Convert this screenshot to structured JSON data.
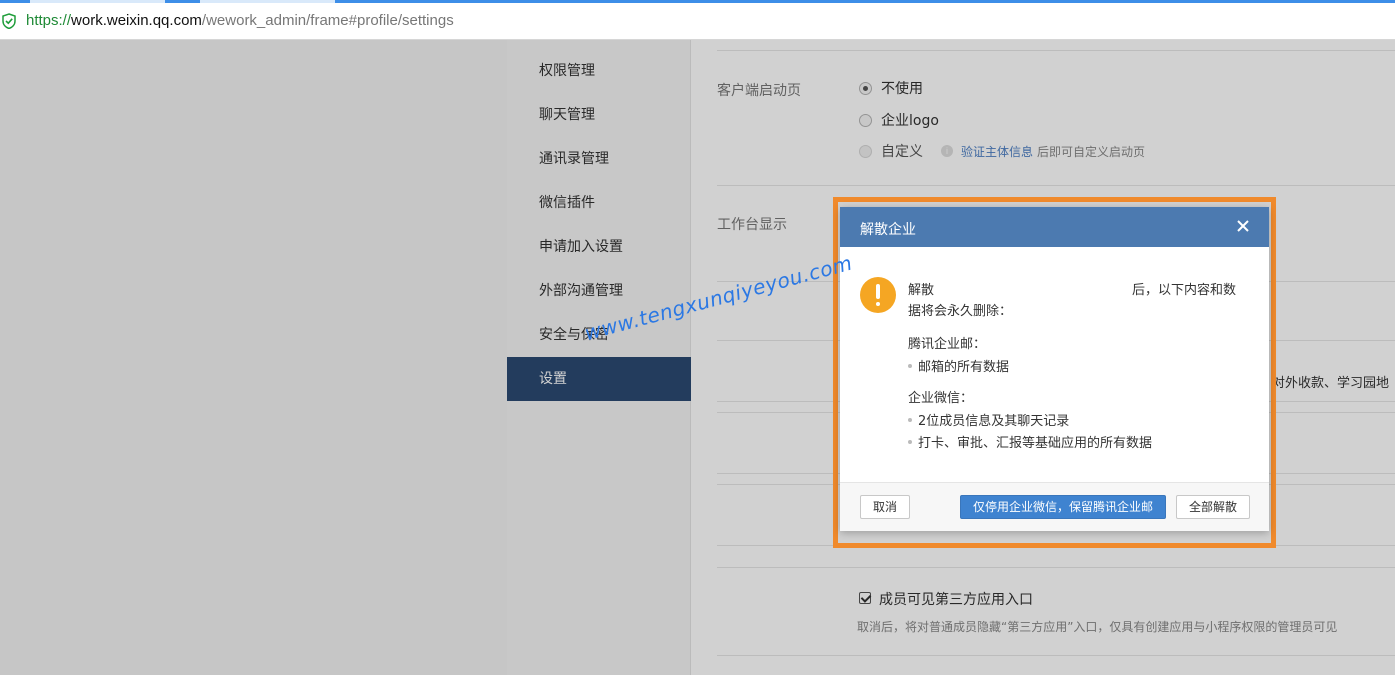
{
  "browser": {
    "url_scheme": "https://",
    "url_host": "work.weixin.qq.com",
    "url_path": "/wework_admin/frame#profile/settings"
  },
  "sidebar": {
    "items": [
      {
        "label": "权限管理"
      },
      {
        "label": "聊天管理"
      },
      {
        "label": "通讯录管理"
      },
      {
        "label": "微信插件"
      },
      {
        "label": "申请加入设置"
      },
      {
        "label": "外部沟通管理"
      },
      {
        "label": "安全与保密"
      },
      {
        "label": "设置",
        "active": true
      }
    ]
  },
  "settings": {
    "launch_page": {
      "label": "客户端启动页",
      "options": [
        {
          "label": "不使用",
          "checked": true
        },
        {
          "label": "企业logo",
          "checked": false
        },
        {
          "label": "自定义",
          "checked": false,
          "disabled": true
        }
      ],
      "verify_link": "验证主体信息",
      "verify_hint": "后即可自定义启动页"
    },
    "workbench": {
      "label": "工作台显示",
      "peek_text": "对外收款、学习园地"
    },
    "third_party": {
      "checkbox_label": "成员可见第三方应用入口",
      "checked": true,
      "description": "取消后，将对普通成员隐藏“第三方应用”入口，仅具有创建应用与小程序权限的管理员可见"
    }
  },
  "dialog": {
    "title": "解散企业",
    "line1_left": "解散",
    "line1_right": "后，以下内容和数",
    "line2": "据将会永久删除：",
    "section1_title": "腾讯企业邮：",
    "section1_items": [
      "邮箱的所有数据"
    ],
    "section2_title": "企业微信：",
    "section2_items": [
      "2位成员信息及其聊天记录",
      "打卡、审批、汇报等基础应用的所有数据"
    ],
    "buttons": {
      "cancel": "取消",
      "primary": "仅停用企业微信，保留腾讯企业邮",
      "dissolve_all": "全部解散"
    }
  },
  "watermark": "www.tengxunqiyeyou.com",
  "colors": {
    "highlight": "#f08a2c",
    "dialog_header": "#4c7ab0",
    "sidebar_active": "#2b4a72",
    "primary_button": "#3f83d0",
    "warning": "#f5a623"
  }
}
